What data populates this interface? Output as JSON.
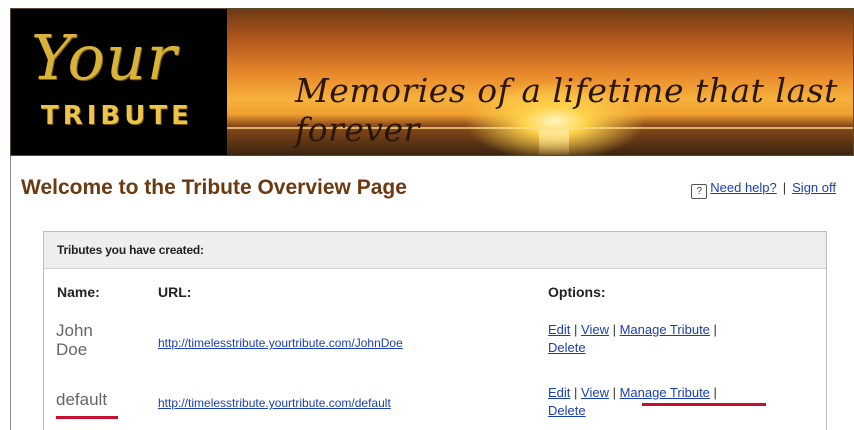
{
  "header": {
    "logo_top": "Your",
    "logo_bottom": "TRIBUTE",
    "tagline": "Memories of a lifetime that last forever"
  },
  "page_title": "Welcome to the Tribute Overview Page",
  "help": {
    "need_help": "Need help?",
    "separator": "|",
    "sign_off": "Sign off"
  },
  "panel": {
    "title": "Tributes you have created:",
    "columns": {
      "name": "Name:",
      "url": "URL:",
      "options": "Options:"
    },
    "rows": [
      {
        "name_line1": "John",
        "name_line2": "Doe",
        "url": "http://timelesstribute.yourtribute.com/JohnDoe",
        "options": {
          "edit": "Edit",
          "view": "View",
          "manage": "Manage Tribute",
          "delete": "Delete"
        }
      },
      {
        "name_line1": "default",
        "url": "http://timelesstribute.yourtribute.com/default",
        "options": {
          "edit": "Edit",
          "view": "View",
          "manage": "Manage Tribute",
          "delete": "Delete"
        }
      }
    ]
  },
  "colors": {
    "title": "#6b3a10",
    "link": "#1a3fb0",
    "annotation": "#c8102e"
  },
  "icons": {
    "help": "question-box-icon"
  }
}
